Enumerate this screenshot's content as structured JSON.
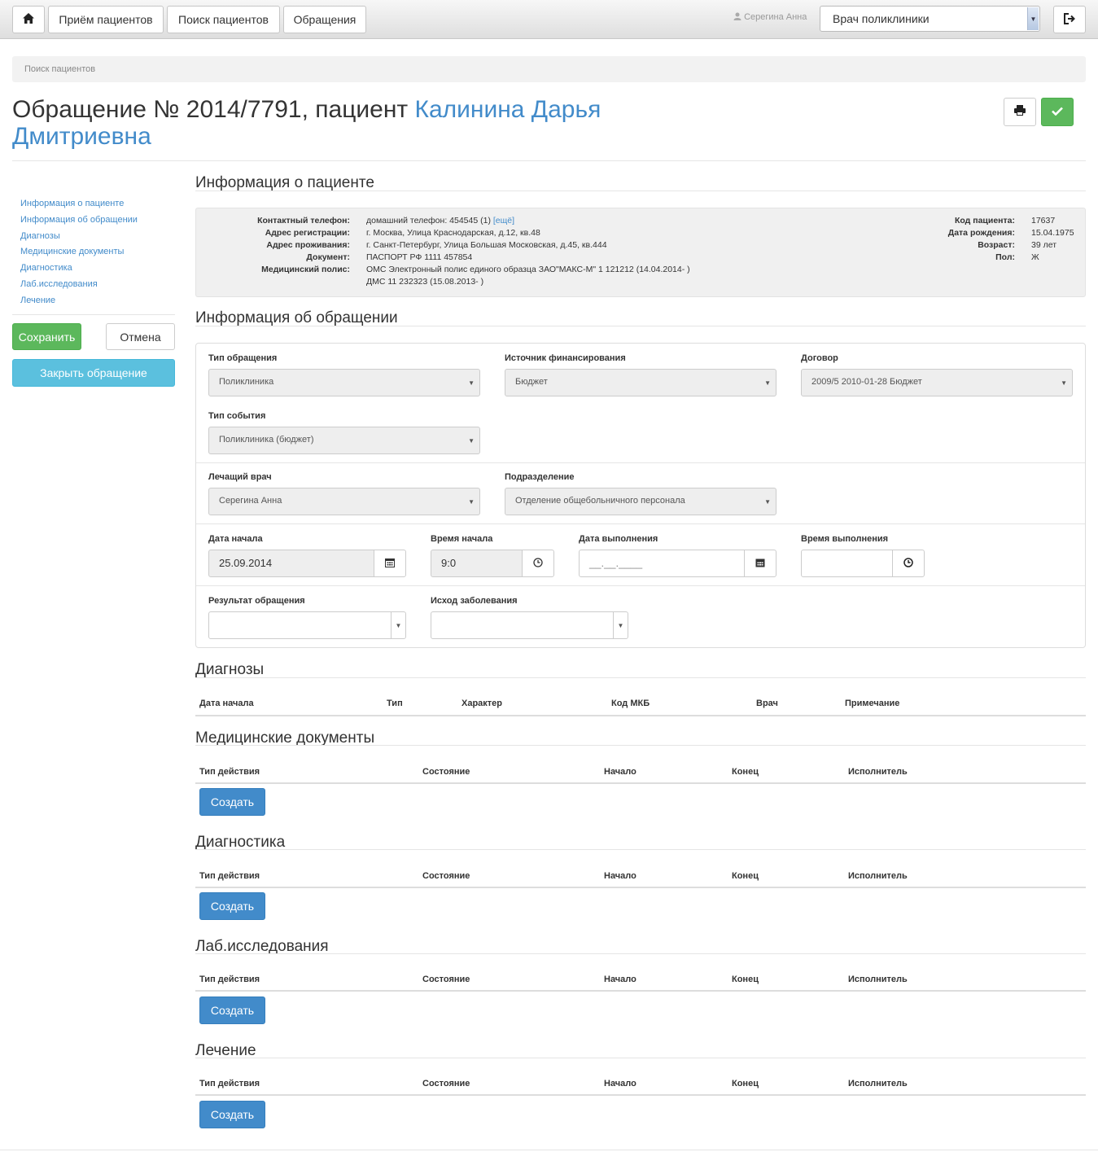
{
  "topbar": {
    "home_icon": "home-icon",
    "nav": [
      "Приём пациентов",
      "Поиск пациентов",
      "Обращения"
    ],
    "user": "Серегина Анна",
    "role": "Врач поликлиники",
    "logout_icon": "logout-icon"
  },
  "breadcrumb": "Поиск пациентов",
  "title": {
    "prefix": "Обращение № 2014/7791, пациент ",
    "patient": "Калинина Дарья Дмитриевна"
  },
  "sidenav": [
    "Информация о пациенте",
    "Информация об обращении",
    "Диагнозы",
    "Медицинские документы",
    "Диагностика",
    "Лаб.исследования",
    "Лечение"
  ],
  "buttons": {
    "save": "Сохранить",
    "cancel": "Отмена",
    "close": "Закрыть обращение",
    "create": "Создать"
  },
  "patient_info": {
    "heading": "Информация о пациенте",
    "phone_label": "Контактный телефон:",
    "phone_value": "домашний телефон: 454545 (1)",
    "phone_more": "[ещё]",
    "reg_label": "Адрес регистрации:",
    "reg_value": "г. Москва, Улица Краснодарская, д.12, кв.48",
    "live_label": "Адрес проживания:",
    "live_value": "г. Санкт-Петербург, Улица Большая Московская, д.45, кв.444",
    "doc_label": "Документ:",
    "doc_value": "ПАСПОРТ РФ 1111 457854",
    "policy_label": "Медицинский полис:",
    "policy_value1": "ОМС Электронный полис единого образца ЗАО\"МАКС-М\" 1 121212 (14.04.2014- )",
    "policy_value2": "ДМС 11 232323 (15.08.2013- )",
    "code_label": "Код пациента:",
    "code_value": "17637",
    "dob_label": "Дата рождения:",
    "dob_value": "15.04.1975",
    "age_label": "Возраст:",
    "age_value": "39 лет",
    "sex_label": "Пол:",
    "sex_value": "Ж"
  },
  "visit": {
    "heading": "Информация об обращении",
    "type_label": "Тип обращения",
    "type_value": "Поликлиника",
    "funding_label": "Источник финансирования",
    "funding_value": "Бюджет",
    "contract_label": "Договор",
    "contract_value": "2009/5 2010-01-28 Бюджет",
    "event_label": "Тип события",
    "event_value": "Поликлиника (бюджет)",
    "doctor_label": "Лечащий врач",
    "doctor_value": "Серегина Анна",
    "dept_label": "Подразделение",
    "dept_value": "Отделение общебольничного персонала",
    "start_date_label": "Дата начала",
    "start_date_value": "25.09.2014",
    "start_time_label": "Время начала",
    "start_time_value": "9:0",
    "end_date_label": "Дата выполнения",
    "end_date_value": "__.__.____",
    "end_time_label": "Время выполнения",
    "end_time_value": "",
    "result_label": "Результат обращения",
    "result_value": "",
    "outcome_label": "Исход заболевания",
    "outcome_value": ""
  },
  "diagnoses": {
    "heading": "Диагнозы",
    "columns": [
      "Дата начала",
      "Тип",
      "Характер",
      "Код МКБ",
      "Врач",
      "Примечание"
    ]
  },
  "action_columns": [
    "Тип действия",
    "Состояние",
    "Начало",
    "Конец",
    "Исполнитель"
  ],
  "sections": [
    "Медицинские документы",
    "Диагностика",
    "Лаб.исследования",
    "Лечение"
  ]
}
